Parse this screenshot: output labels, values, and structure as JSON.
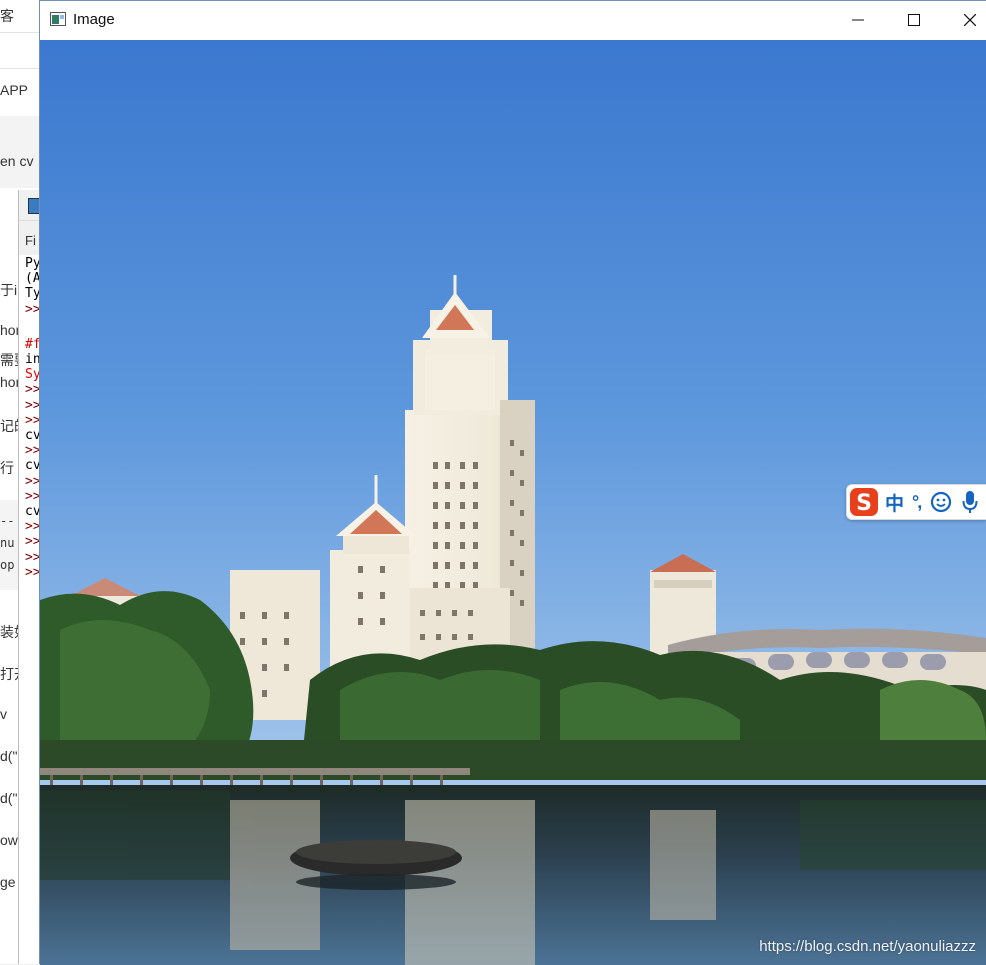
{
  "background": {
    "browser_fragments": [
      "客",
      "APP",
      "en cv"
    ],
    "left_texts": [
      "于i",
      "hon",
      "需要",
      "hon",
      "记的",
      "行",
      "--",
      "nu",
      "op",
      "装如",
      "打开",
      "v",
      "d(\"D",
      "d(\"D",
      "ow(",
      "ge"
    ],
    "idle": {
      "menu_fragment": "Fi",
      "lines": [
        {
          "text": "Py",
          "color": "#000000"
        },
        {
          "text": "(A",
          "color": "#000000"
        },
        {
          "text": "Ty",
          "color": "#000000"
        },
        {
          "text": ">>",
          "color": "#800000"
        },
        {
          "text": "",
          "color": "#000000"
        },
        {
          "text": "#f",
          "color": "#dd0000"
        },
        {
          "text": "in",
          "color": "#000000"
        },
        {
          "text": "Sy",
          "color": "#dd0000"
        },
        {
          "text": ">>",
          "color": "#800000"
        },
        {
          "text": ">>",
          "color": "#800000"
        },
        {
          "text": ">>",
          "color": "#800000"
        },
        {
          "text": "cv",
          "color": "#000000"
        },
        {
          "text": ">>",
          "color": "#800000"
        },
        {
          "text": "cv",
          "color": "#000000"
        },
        {
          "text": ">>",
          "color": "#800000"
        },
        {
          "text": ">>",
          "color": "#800000"
        },
        {
          "text": "cv",
          "color": "#000000"
        },
        {
          "text": ">>",
          "color": "#800000"
        },
        {
          "text": ">>",
          "color": "#800000"
        },
        {
          "text": ">>",
          "color": "#800000"
        },
        {
          "text": ">>",
          "color": "#800000"
        }
      ]
    }
  },
  "window": {
    "title": "Image",
    "icon": "opencv-window-icon",
    "controls": [
      "minimize-icon",
      "maximize-icon",
      "close-icon"
    ]
  },
  "image": {
    "description_icon": "campus-tower-lake-photo",
    "watermark": "https://blog.csdn.net/yaonuliazzz"
  },
  "ime": {
    "logo": "sogou-s-icon",
    "mode_label": "中",
    "punct_label": "°,",
    "icons": [
      "emoji-icon",
      "microphone-icon"
    ],
    "accent": "#1565c0",
    "logo_color": "#e8401c"
  }
}
